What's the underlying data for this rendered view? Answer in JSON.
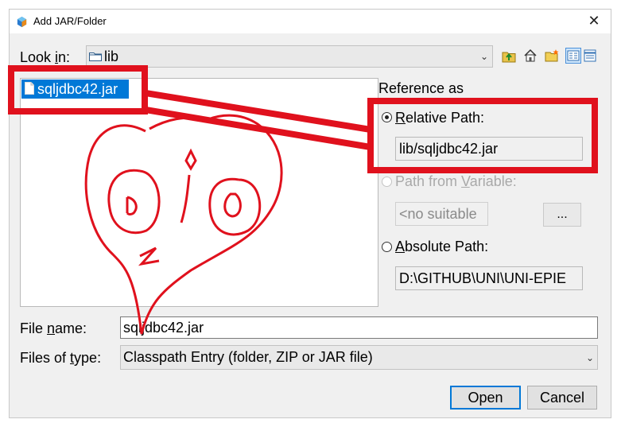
{
  "window": {
    "title": "Add JAR/Folder",
    "close_glyph": "✕"
  },
  "lookin": {
    "label_pre": "Look ",
    "label_mn": "i",
    "label_post": "n:",
    "value": "lib",
    "arrow": "⌄"
  },
  "files": [
    {
      "name": "sqljdbc42.jar",
      "selected": true
    }
  ],
  "reference": {
    "title": "Reference as",
    "relative": {
      "mn": "R",
      "rest": "elative Path:",
      "value": "lib/sqljdbc42.jar",
      "selected": true
    },
    "variable": {
      "pre": "Path from ",
      "mn": "V",
      "post": "ariable:",
      "value": "<no suitable",
      "button": "...",
      "enabled": false
    },
    "absolute": {
      "mn": "A",
      "rest": "bsolute Path:",
      "value": "D:\\GITHUB\\UNI\\UNI-EPIE"
    }
  },
  "file_name": {
    "pre": "File ",
    "mn": "n",
    "post": "ame:",
    "value": "sqljdbc42.jar"
  },
  "file_type": {
    "pre": "Files of ",
    "mn": "t",
    "post": "ype:",
    "value": "Classpath Entry (folder, ZIP or JAR file)",
    "arrow": "⌄"
  },
  "buttons": {
    "open": "Open",
    "cancel": "Cancel"
  },
  "icons": [
    "netbeans-icon",
    "up-folder-icon",
    "home-icon",
    "new-folder-icon",
    "list-view-icon",
    "details-view-icon",
    "folder-icon",
    "file-icon"
  ],
  "colors": {
    "selection": "#0078d7",
    "annotation": "#e0111d"
  }
}
